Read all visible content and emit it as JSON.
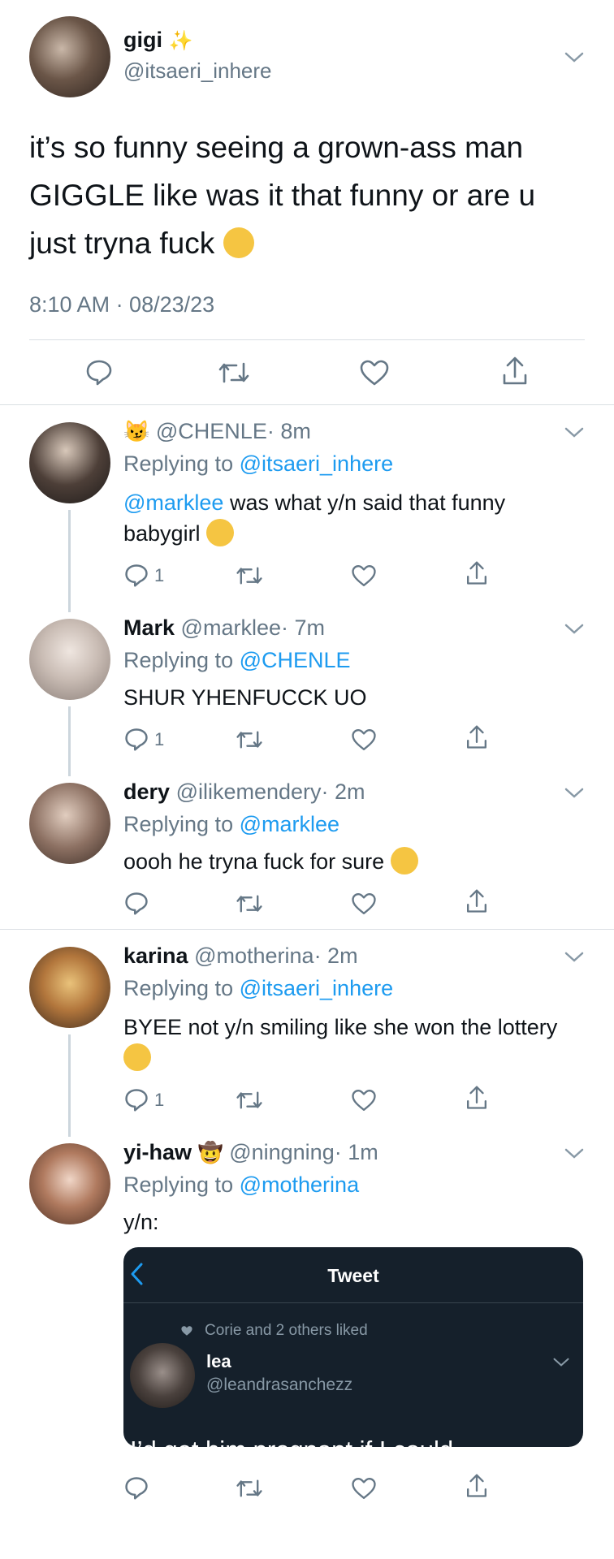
{
  "main_tweet": {
    "name": "gigi",
    "name_emoji": "✨",
    "handle": "@itsaeri_inhere",
    "text": "it’s so funny seeing a grown-ass man GIGGLE like was it that funny or are u just tryna fuck",
    "text_emoji": "🤨",
    "timestamp": "8:10 AM · 08/23/23"
  },
  "replies": [
    {
      "name": "",
      "name_emoji": "😼",
      "handle": "@CHENLE",
      "time": "· 8m",
      "replying_label": "Replying to",
      "replying_to": "@itsaeri_inhere",
      "mention": "@marklee",
      "text": " was what y/n said that funny babygirl",
      "text_emoji": "🤭",
      "reply_count": "1"
    },
    {
      "name": "Mark",
      "handle": "@marklee",
      "time": "· 7m",
      "replying_label": "Replying to",
      "replying_to": "@CHENLE",
      "text": "SHUR YHENFUCCK UO",
      "reply_count": "1"
    },
    {
      "name": "dery",
      "handle": "@ilikemendery",
      "time": "· 2m",
      "replying_label": "Replying to",
      "replying_to": "@marklee",
      "text": "oooh he tryna fuck for sure",
      "text_emoji": "🥴",
      "reply_count": ""
    },
    {
      "name": "karina",
      "handle": "@motherina",
      "time": "· 2m",
      "replying_label": "Replying to",
      "replying_to": "@itsaeri_inhere",
      "text": "BYEE not y/n smiling like she won the lottery",
      "text_emoji": "😭",
      "reply_count": "1"
    },
    {
      "name": "yi-haw",
      "name_emoji": "🤠",
      "handle": "@ningning",
      "time": "· 1m",
      "replying_label": "Replying to",
      "replying_to": "@motherina",
      "text": "y/n:",
      "reply_count": ""
    }
  ],
  "embedded_screenshot": {
    "header_title": "Tweet",
    "liked_text": "Corie and 2 others liked",
    "name": "lea",
    "handle": "@leandrasanchezz",
    "text": "I’d get him pregnant if I could"
  },
  "icons": [
    "reply-icon",
    "retweet-icon",
    "like-icon",
    "share-icon",
    "chevron-down-icon",
    "back-arrow-icon",
    "heart-icon"
  ],
  "colors": {
    "accent": "#1d9bf0",
    "gray": "#657786",
    "dark_bg": "#15202b"
  }
}
